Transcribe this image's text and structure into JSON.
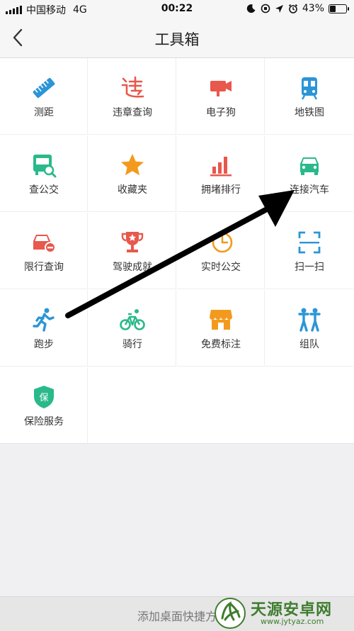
{
  "status_bar": {
    "carrier": "中国移动",
    "network": "4G",
    "time": "00:22",
    "battery": "43%",
    "battery_level": 0.43
  },
  "header": {
    "title": "工具箱",
    "back_icon": "chevron-left-icon"
  },
  "tools": [
    {
      "label": "测距",
      "icon": "ruler-icon",
      "color": "#2b95d6"
    },
    {
      "label": "违章查询",
      "icon": "violation-icon",
      "color": "#e8584c"
    },
    {
      "label": "电子狗",
      "icon": "camera-icon",
      "color": "#e8584c"
    },
    {
      "label": "地铁图",
      "icon": "metro-icon",
      "color": "#2b95d6"
    },
    {
      "label": "查公交",
      "icon": "bus-search-icon",
      "color": "#2ab98a"
    },
    {
      "label": "收藏夹",
      "icon": "star-icon",
      "color": "#f39a1e"
    },
    {
      "label": "拥堵排行",
      "icon": "bar-chart-icon",
      "color": "#e8584c"
    },
    {
      "label": "连接汽车",
      "icon": "car-icon",
      "color": "#2ab98a"
    },
    {
      "label": "限行查询",
      "icon": "restricted-car-icon",
      "color": "#e8584c"
    },
    {
      "label": "驾驶成就",
      "icon": "trophy-icon",
      "color": "#e8584c"
    },
    {
      "label": "实时公交",
      "icon": "clock-icon",
      "color": "#f39a1e"
    },
    {
      "label": "扫一扫",
      "icon": "scan-icon",
      "color": "#2b95d6"
    },
    {
      "label": "跑步",
      "icon": "runner-icon",
      "color": "#2b95d6"
    },
    {
      "label": "骑行",
      "icon": "bicycle-icon",
      "color": "#2ab98a"
    },
    {
      "label": "免费标注",
      "icon": "shop-icon",
      "color": "#f39a1e"
    },
    {
      "label": "组队",
      "icon": "team-icon",
      "color": "#2b95d6"
    },
    {
      "label": "保险服务",
      "icon": "shield-icon",
      "color": "#2ab98a"
    }
  ],
  "insurance_glyph": "保",
  "bottom_bar": {
    "label": "添加桌面快捷方"
  },
  "watermark": {
    "name": "天源安卓网",
    "url": "www.jytyaz.com"
  }
}
